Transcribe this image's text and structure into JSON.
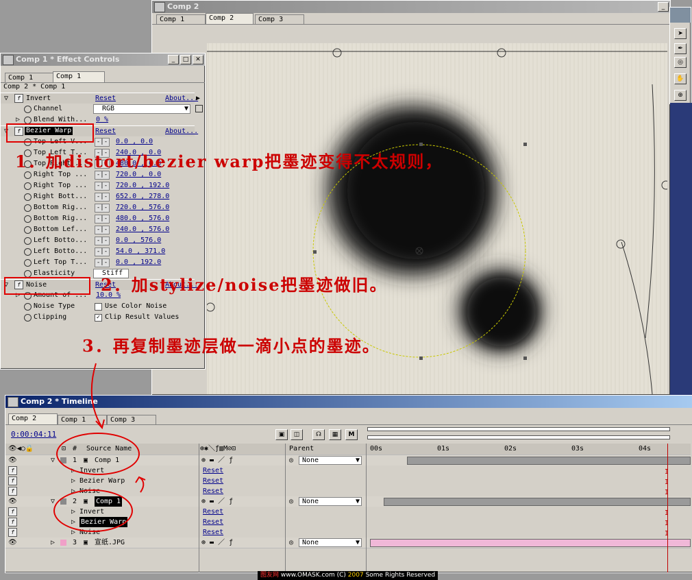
{
  "comp_window": {
    "title": "Comp 2",
    "tabs": [
      "Comp 1",
      "Comp 2",
      "Comp 3"
    ]
  },
  "effect_controls": {
    "title": "Comp 1 * Effect Controls",
    "tabs": [
      "Comp 1",
      "Comp 1"
    ],
    "breadcrumb": "Comp 2 * Comp 1",
    "invert": {
      "name": "Invert",
      "reset": "Reset",
      "about": "About...",
      "channel_label": "Channel",
      "channel_value": "RGB",
      "blend_label": "Blend With...",
      "blend_value": "0 %"
    },
    "bezier": {
      "name": "Bezier Warp",
      "reset": "Reset",
      "about": "About...",
      "rows": [
        {
          "label": "Top Left V...",
          "value": "0.0 , 0.0"
        },
        {
          "label": "Top Left T...",
          "value": "240.0 , 0.0"
        },
        {
          "label": "Top Right ...",
          "value": "480.0 , 0.0"
        },
        {
          "label": "Right Top ...",
          "value": "720.0 , 0.0"
        },
        {
          "label": "Right Top ...",
          "value": "720.0 , 192.0"
        },
        {
          "label": "Right Bott...",
          "value": "652.0 , 278.0"
        },
        {
          "label": "Bottom Rig...",
          "value": "720.0 , 576.0"
        },
        {
          "label": "Bottom Rig...",
          "value": "480.0 , 576.0"
        },
        {
          "label": "Bottom Lef...",
          "value": "240.0 , 576.0"
        },
        {
          "label": "Left Botto...",
          "value": "0.0 , 576.0"
        },
        {
          "label": "Left Botto...",
          "value": "54.0 , 371.0"
        },
        {
          "label": "Left Top T...",
          "value": "0.0 , 192.0"
        }
      ],
      "elasticity_label": "Elasticity",
      "elasticity_value": "Stiff"
    },
    "noise": {
      "name": "Noise",
      "reset": "Reset",
      "about": "About...",
      "amount_label": "Amount of ...",
      "amount_value": "10.0 %",
      "type_label": "Noise Type",
      "type_value": "Use Color Noise",
      "clip_label": "Clipping",
      "clip_value": "Clip Result Values"
    }
  },
  "annotations": {
    "step1": "1．加distort/bezier warp把墨迹变得不太规则，",
    "step2": "2．加stylize/noise把墨迹做旧。",
    "step3": "3．再复制墨迹层做一滴小点的墨迹。"
  },
  "timeline": {
    "title": "Comp 2 * Timeline",
    "tabs": [
      "Comp 2",
      "Comp 1",
      "Comp 3"
    ],
    "time": "0:00:04:11",
    "col_hash": "#",
    "col_source": "Source Name",
    "col_parent": "Parent",
    "ruler": [
      "00s",
      "01s",
      "02s",
      "03s",
      "04s"
    ],
    "layers": [
      {
        "num": "1",
        "name": "Comp 1",
        "parent": "None",
        "effects": [
          {
            "name": "Invert",
            "reset": "Reset"
          },
          {
            "name": "Bezier Warp",
            "reset": "Reset"
          },
          {
            "name": "Noise",
            "reset": "Reset"
          }
        ]
      },
      {
        "num": "2",
        "name": "Comp 1",
        "parent": "None",
        "effects": [
          {
            "name": "Invert",
            "reset": "Reset"
          },
          {
            "name": "Bezier Warp",
            "reset": "Reset"
          },
          {
            "name": "Noise",
            "reset": "Reset"
          }
        ]
      },
      {
        "num": "3",
        "name": "宣纸.JPG",
        "parent": "None"
      }
    ]
  },
  "footer": {
    "site": "图友网",
    "url": "www.OMASK.com",
    "copyright": "(C)",
    "year": "2007",
    "rights": "Some Rights Reserved"
  },
  "colors": {
    "annotation_red": "#cc0000",
    "active_title": "#0a246a",
    "layer3_bar": "#f0b8d8"
  }
}
